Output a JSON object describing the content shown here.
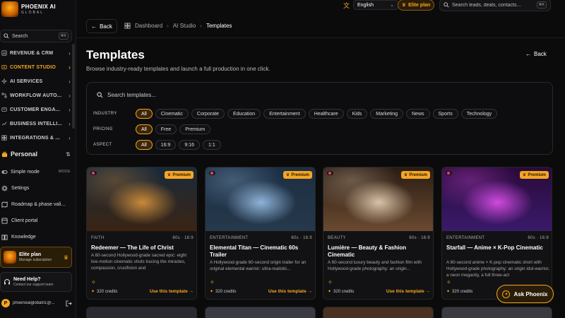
{
  "brand": {
    "name": "PHOENIX AI",
    "sub": "GLOBAL"
  },
  "sidebar": {
    "search_label": "Search",
    "search_kbd": "⌘K",
    "groups": [
      {
        "label": "REVENUE & CRM",
        "icon": "revenue-icon"
      },
      {
        "label": "CONTENT STUDIO",
        "icon": "content-icon",
        "active": true
      },
      {
        "label": "AI SERVICES",
        "icon": "ai-icon"
      },
      {
        "label": "WORKFLOW AUTO...",
        "icon": "workflow-icon"
      },
      {
        "label": "CUSTOMER ENGA...",
        "icon": "customer-icon"
      },
      {
        "label": "BUSINESS INTELLI...",
        "icon": "bi-icon"
      },
      {
        "label": "INTEGRATIONS & ...",
        "icon": "integrations-icon"
      }
    ],
    "personal_label": "Personal",
    "simple_mode_label": "Simple mode",
    "simple_mode_badge": "MODE",
    "links": [
      {
        "label": "Settings",
        "icon": "gear-icon"
      },
      {
        "label": "Roadmap & phase vali...",
        "icon": "map-icon"
      },
      {
        "label": "Client portal",
        "icon": "portal-icon"
      },
      {
        "label": "Knowledge",
        "icon": "book-icon"
      }
    ],
    "elite_title": "Elite plan",
    "elite_sub": "Manage subscription",
    "help_title": "Need Help?",
    "help_sub": "Contact our support team",
    "user_initial": "P",
    "user_email": "phoenixalglobal01@..."
  },
  "topbar": {
    "language": "English",
    "elite_label": "Elite plan",
    "search_placeholder": "Search leads, deals, contacts...",
    "search_kbd": "⌘K"
  },
  "breadcrumb": {
    "back_label": "Back",
    "items": [
      "Dashboard",
      "AI Studio",
      "Templates"
    ]
  },
  "page": {
    "title": "Templates",
    "subtitle": "Browse industry-ready templates and launch a full production in one click.",
    "back_label": "Back"
  },
  "filters": {
    "search_placeholder": "Search templates...",
    "industry": {
      "label": "INDUSTRY",
      "options": [
        "All",
        "Cinematic",
        "Corporate",
        "Education",
        "Entertainment",
        "Healthcare",
        "Kids",
        "Marketing",
        "News",
        "Sports",
        "Technology"
      ],
      "selected": 0
    },
    "pricing": {
      "label": "PRICING",
      "options": [
        "All",
        "Free",
        "Premium"
      ],
      "selected": 0
    },
    "aspect": {
      "label": "ASPECT",
      "options": [
        "All",
        "16:9",
        "9:16",
        "1:1"
      ],
      "selected": 0
    }
  },
  "cards": [
    {
      "badge": "Premium",
      "category": "FAITH",
      "meta": "60s · 16:9",
      "title": "Redeemer — The Life of Christ",
      "desc": "A 60-second Hollywood-grade sacred epic: eight live-motion cinematic shots tracing the miracles, compassion, crucifixion and",
      "credits": "320 credits",
      "cta": "Use this template →",
      "palette": [
        "#1a2a3a",
        "#c98a3a",
        "#3a2414"
      ]
    },
    {
      "badge": "Premium",
      "category": "ENTERTAINMENT",
      "meta": "60s · 16:9",
      "title": "Elemental Titan — Cinematic 60s Trailer",
      "desc": "A Hollywood-grade 60-second origin trailer for an original elemental warrior: ultra-realistic...",
      "credits": "320 credits",
      "cta": "Use this template →",
      "palette": [
        "#1c2f44",
        "#8fb4d8",
        "#26384a"
      ]
    },
    {
      "badge": "Premium",
      "category": "BEAUTY",
      "meta": "60s · 16:9",
      "title": "Lumière — Beauty & Fashion Cinematic",
      "desc": "A 60-second luxury beauty and fashion film with Hollywood-grade photography: an origin...",
      "credits": "320 credits",
      "cta": "Use this template →",
      "palette": [
        "#2a1c14",
        "#d9c3a8",
        "#6a4a30"
      ]
    },
    {
      "badge": "Premium",
      "category": "ENTERTAINMENT",
      "meta": "60s · 16:9",
      "title": "Starfall — Anime × K-Pop Cinematic",
      "desc": "A 60-second anime × K-pop cinematic short with Hollywood-grade photography: an origin idol-warrior, a neon megacity, a full three-act",
      "credits": "320 credits",
      "cta": "Use this template →",
      "palette": [
        "#2a0a3a",
        "#d04adf",
        "#3a1a6a"
      ]
    }
  ],
  "ask": {
    "label": "Ask Phoenix"
  }
}
